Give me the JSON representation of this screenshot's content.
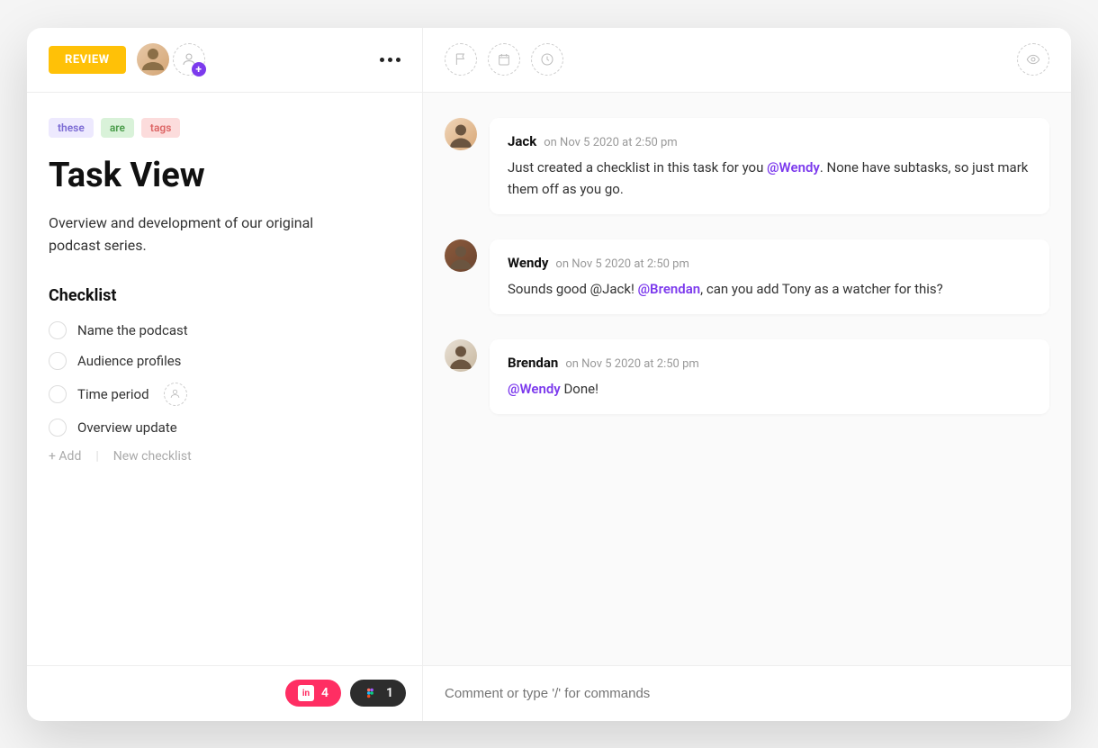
{
  "header": {
    "status_label": "REVIEW"
  },
  "tags": [
    {
      "label": "these",
      "class": "tag-purple"
    },
    {
      "label": "are",
      "class": "tag-green"
    },
    {
      "label": "tags",
      "class": "tag-red"
    }
  ],
  "task": {
    "title": "Task View",
    "description": "Overview and development of our original podcast series."
  },
  "checklist": {
    "heading": "Checklist",
    "items": [
      {
        "label": "Name the podcast",
        "has_assign": false
      },
      {
        "label": "Audience profiles",
        "has_assign": false
      },
      {
        "label": "Time period",
        "has_assign": true
      },
      {
        "label": "Overview update",
        "has_assign": false
      }
    ],
    "add_label": "+ Add",
    "new_label": "New checklist"
  },
  "comments": [
    {
      "author": "Jack",
      "date_prefix": "on ",
      "date": "Nov 5 2020 at 2:50 pm",
      "text_before": "Just created a checklist in this task for you ",
      "mention": "@Wendy",
      "text_after": ". None have subtasks, so just mark them off as you go.",
      "avatar_class": "jack"
    },
    {
      "author": "Wendy",
      "date_prefix": "on ",
      "date": "Nov 5 2020 at 2:50 pm",
      "text_before": "Sounds good @Jack! ",
      "mention": "@Brendan",
      "text_after": ", can you add Tony as a watcher for this?",
      "avatar_class": "wendy"
    },
    {
      "author": "Brendan",
      "date_prefix": "on ",
      "date": "Nov 5 2020 at 2:50 pm",
      "text_before": "",
      "mention": "@Wendy",
      "text_after": " Done!",
      "avatar_class": "brendan"
    }
  ],
  "footer": {
    "pink_count": "4",
    "dark_count": "1",
    "comment_placeholder": "Comment or type '/' for commands"
  }
}
